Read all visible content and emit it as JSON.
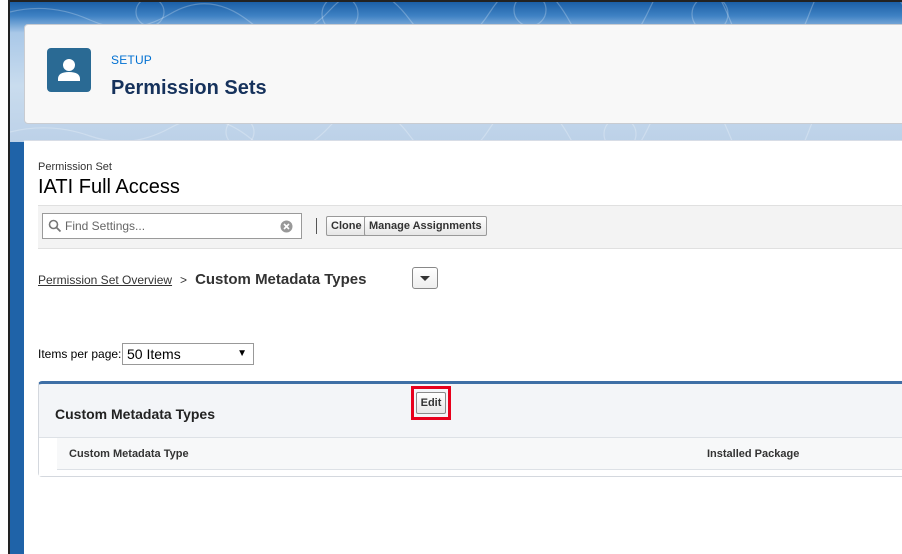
{
  "header": {
    "eyebrow": "SETUP",
    "title": "Permission Sets",
    "icon": "user-icon"
  },
  "permission_set": {
    "label": "Permission Set",
    "name": "IATI Full Access"
  },
  "toolbar": {
    "search_placeholder": "Find Settings...",
    "clone_label": "Clone",
    "manage_assignments_label": "Manage Assignments"
  },
  "breadcrumb": {
    "overview_link": "Permission Set Overview",
    "separator": ">",
    "current": "Custom Metadata Types"
  },
  "pagination": {
    "items_per_page_label": "Items per page:",
    "items_per_page_value": "50 Items"
  },
  "panel": {
    "title": "Custom Metadata Types",
    "edit_label": "Edit",
    "columns": [
      "Custom Metadata Type",
      "Installed Package"
    ]
  },
  "colors": {
    "highlight": "#e8001c",
    "brand_blue": "#1f63a8",
    "link_blue": "#0070d2"
  }
}
